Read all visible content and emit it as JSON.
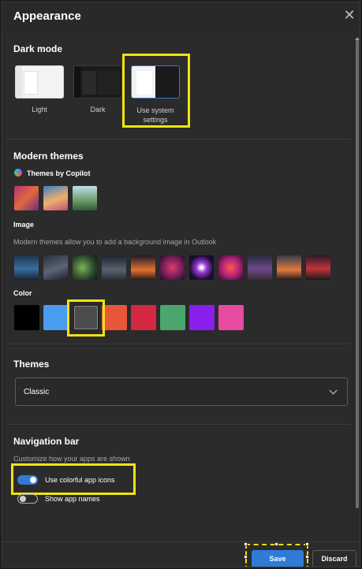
{
  "dialog": {
    "title": "Appearance"
  },
  "dark_mode": {
    "heading": "Dark mode",
    "options": [
      {
        "label": "Light"
      },
      {
        "label": "Dark"
      },
      {
        "label": "Use system settings"
      }
    ],
    "selected": "Use system settings"
  },
  "modern_themes": {
    "heading": "Modern themes",
    "copilot_label": "Themes by Copilot",
    "image_label": "Image",
    "image_desc": "Modern themes allow you to add a background image in Outlook",
    "color_label": "Color",
    "colors": [
      "#000000",
      "#4a9cf0",
      "#4c4c4c",
      "#e8553a",
      "#d3283f",
      "#4aa56e",
      "#8a1eea",
      "#e64aa1"
    ],
    "selected_color_index": 2
  },
  "themes": {
    "heading": "Themes",
    "selected": "Classic"
  },
  "navigation_bar": {
    "heading": "Navigation bar",
    "desc": "Customize how your apps are shown",
    "toggles": [
      {
        "label": "Use colorful app icons",
        "on": true
      },
      {
        "label": "Show app names",
        "on": false
      }
    ]
  },
  "footer": {
    "save_label": "Save",
    "discard_label": "Discard"
  },
  "colors": {
    "highlight": "#f2e30f",
    "accent": "#2f7bd6",
    "panel": "#292929"
  }
}
